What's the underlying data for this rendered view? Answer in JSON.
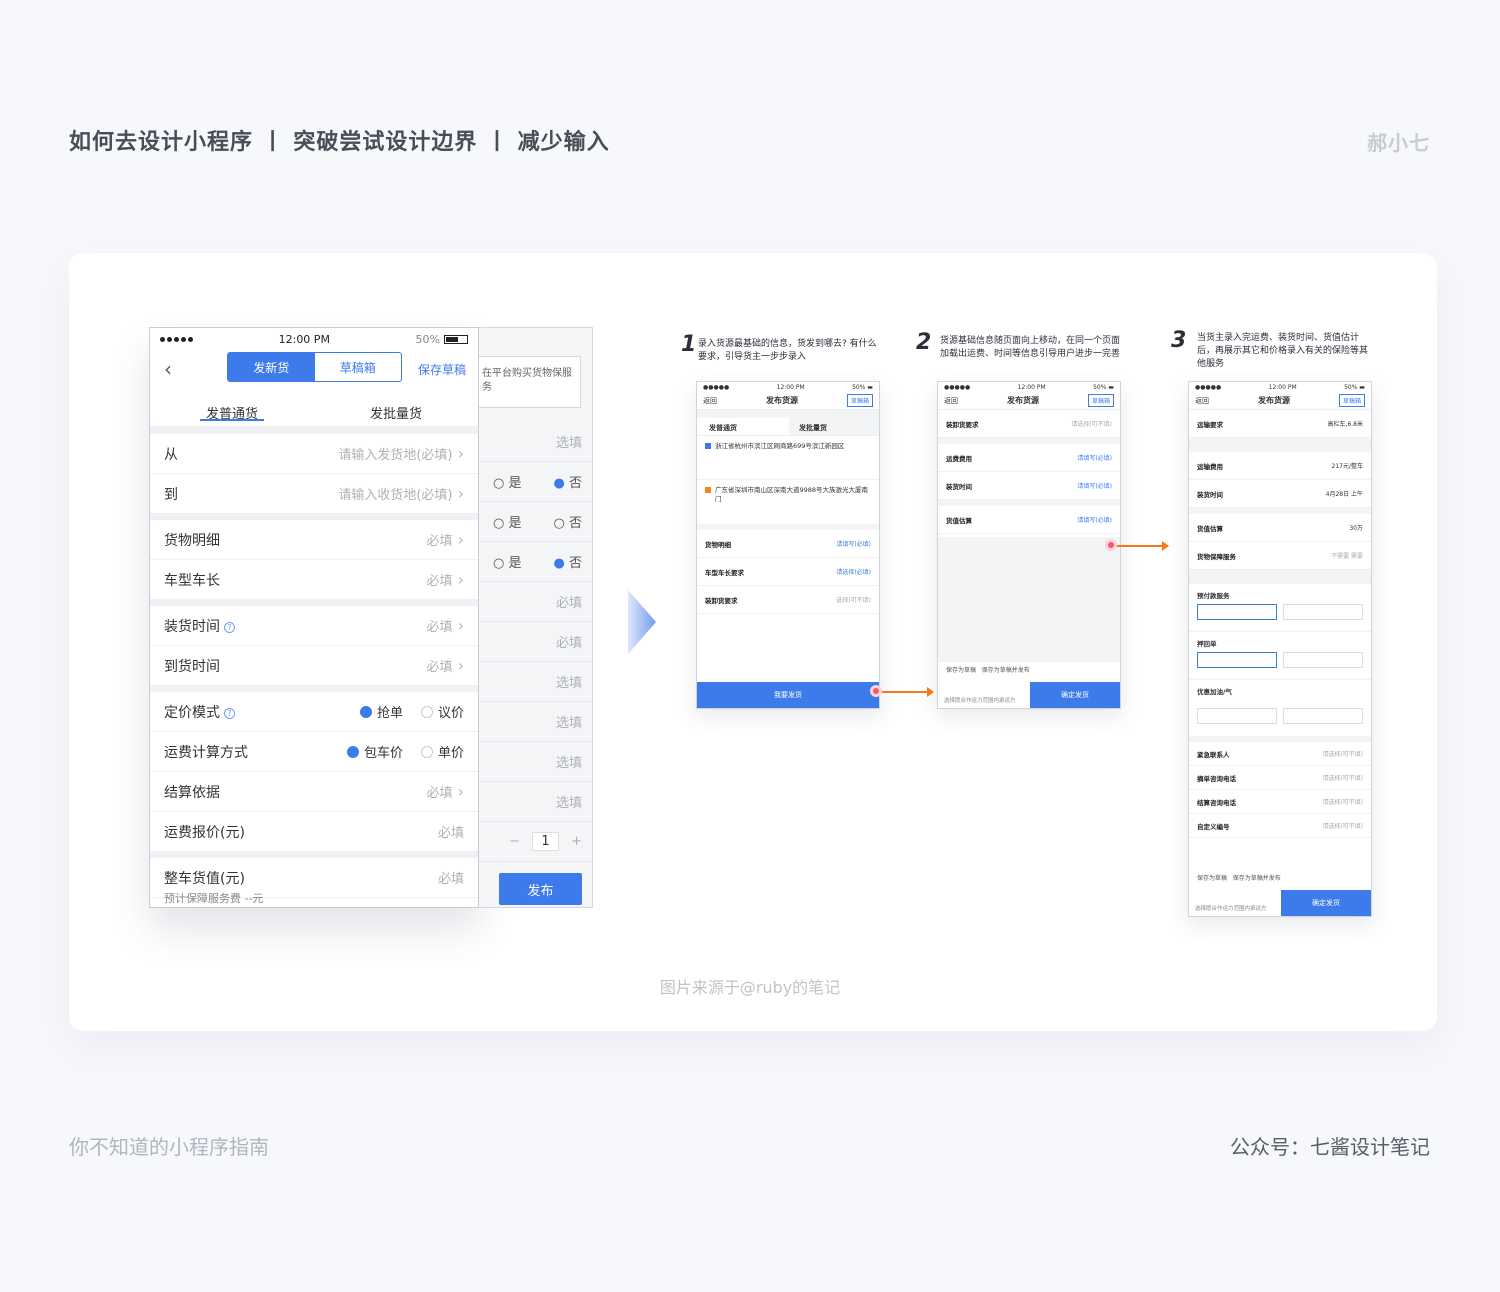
{
  "header": {
    "title": "如何去设计小程序 丨 突破尝试设计边界 丨 减少输入",
    "author": "郝小七"
  },
  "footer": {
    "left": "你不知道的小程序指南",
    "right": "公众号：七酱设计笔记"
  },
  "caption": "图片来源于@ruby的笔记",
  "big_phone": {
    "status": {
      "time": "12:00 PM",
      "battery": "50%"
    },
    "segments": [
      "发新货",
      "草稿箱"
    ],
    "save_draft": "保存草稿",
    "tabs": [
      "发普通货",
      "发批量货"
    ],
    "rows": [
      {
        "label": "从",
        "value": "请输入发货地(必填)"
      },
      {
        "label": "到",
        "value": "请输入收货地(必填)"
      },
      {
        "label": "货物明细",
        "value": "必填"
      },
      {
        "label": "车型车长",
        "value": "必填"
      },
      {
        "label": "装货时间",
        "value": "必填"
      },
      {
        "label": "到货时间",
        "value": "必填"
      },
      {
        "label": "定价模式",
        "opt1": "抢单",
        "opt2": "议价"
      },
      {
        "label": "运费计算方式",
        "opt1": "包车价",
        "opt2": "单价"
      },
      {
        "label": "结算依据",
        "value": "必填"
      },
      {
        "label": "运费报价(元)",
        "value": "必填"
      },
      {
        "label": "整车货值(元)",
        "value": "必填"
      }
    ],
    "sub_note": "预计保障服务费 --元"
  },
  "back_panel": {
    "note": "在平台购买货物保服务",
    "rows": [
      "选填",
      "是|否",
      "是|否",
      "是|否",
      "必填",
      "必填",
      "选填",
      "选填",
      "选填",
      "选填"
    ],
    "stepper": "1",
    "publish": "发布"
  },
  "steps": [
    {
      "num": "1",
      "text": "录入货源最基础的信息，货发到哪去? 有什么要求，引导货主一步步录入"
    },
    {
      "num": "2",
      "text": "货源基础信息随页面向上移动，在同一个页面加载出运费、时间等信息引导用户进步一完善"
    },
    {
      "num": "3",
      "text": "当货主录入完运费、装货时间、货值估计后，再展示其它和价格录入有关的保险等其他服务"
    }
  ],
  "phone1": {
    "back": "返回",
    "title": "发布货源",
    "tag": "草稿箱",
    "tab1": "发普通货",
    "tab2": "发批量货",
    "addr1": "浙江省杭州市滨江区网商路699号滨江新园区",
    "addr2": "广东省深圳市南山区深南大道9988号大族激光大厦南门",
    "rows": [
      {
        "l": "货物明细",
        "r": "请填写(必填)"
      },
      {
        "l": "车型车长要求",
        "r": "请选择(必填)"
      },
      {
        "l": "装卸货要求",
        "r": "选择(可不填)"
      }
    ],
    "button": "我要发货"
  },
  "phone2": {
    "back": "返回",
    "title": "发布货源",
    "tag": "草稿箱",
    "rows": [
      {
        "l": "装卸货要求",
        "r": "请选择(可不填)"
      },
      {
        "l": "运费费用",
        "r": "请填写(必填)"
      },
      {
        "l": "装货时间",
        "r": "请填写(必填)"
      },
      {
        "l": "货值估算",
        "r": "请填写(必填)"
      }
    ],
    "opt1": "保存为草稿",
    "opt2": "保存为草稿并发布",
    "foot": "选择愿合作运力范围内承运方",
    "button": "确定发货"
  },
  "phone3": {
    "back": "返回",
    "title": "发布货源",
    "tag": "草稿箱",
    "rows": [
      {
        "l": "运输要求",
        "r": "高栏车,6.8米"
      },
      {
        "l": "运输费用",
        "r": "217元/整车"
      },
      {
        "l": "装货时间",
        "r": "4月28日 上午"
      },
      {
        "l": "货值估算",
        "r": "30万"
      },
      {
        "l": "货物保障服务",
        "r": "不需要  需要"
      }
    ],
    "services": [
      "预付款服务",
      "押回单",
      "优惠加油/气"
    ],
    "contacts": [
      "紧急联系人",
      "摘单咨询电话",
      "结算咨询电话",
      "自定义编号"
    ],
    "contact_value": "请选择(可不填)",
    "opt1": "保存为草稿",
    "opt2": "保存为草稿并发布",
    "foot": "选择愿合作运力范围内承运方",
    "button": "确定发货"
  }
}
